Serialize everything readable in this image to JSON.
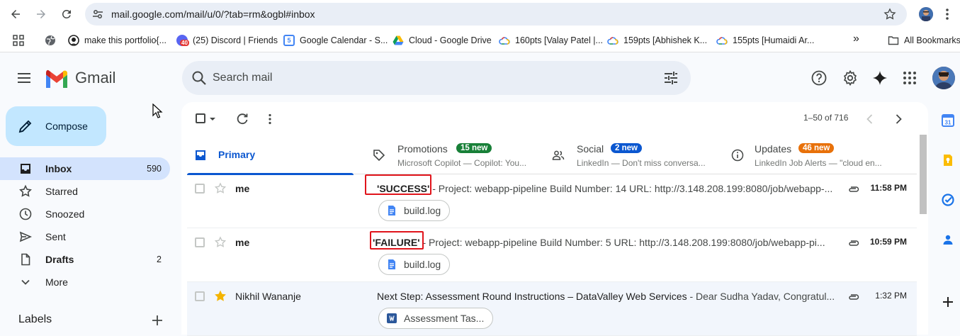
{
  "browser": {
    "url": "mail.google.com/mail/u/0/?tab=rm&ogbl#inbox",
    "bookmarks": [
      {
        "label": "make this portfolio{..."
      },
      {
        "label": "(25) Discord | Friends"
      },
      {
        "label": "Google Calendar - S..."
      },
      {
        "label": "Cloud - Google Drive"
      },
      {
        "label": "160pts [Valay Patel |..."
      },
      {
        "label": "159pts [Abhishek K..."
      },
      {
        "label": "155pts [Humaidi Ar..."
      }
    ],
    "overflow_label": "»",
    "all_bookmarks": "All Bookmarks",
    "discord_badge": "40"
  },
  "gmail": {
    "wordmark": "Gmail",
    "search_placeholder": "Search mail",
    "compose_label": "Compose"
  },
  "sidebar": {
    "items": [
      {
        "label": "Inbox",
        "count": "590"
      },
      {
        "label": "Starred",
        "count": ""
      },
      {
        "label": "Snoozed",
        "count": ""
      },
      {
        "label": "Sent",
        "count": ""
      },
      {
        "label": "Drafts",
        "count": "2"
      },
      {
        "label": "More",
        "count": ""
      }
    ],
    "labels_title": "Labels"
  },
  "toolbar": {
    "page_info": "1–50 of 716"
  },
  "tabs": [
    {
      "title": "Primary",
      "badge": "",
      "subtitle": ""
    },
    {
      "title": "Promotions",
      "badge": "15 new",
      "subtitle": "Microsoft Copilot — Copilot: You...",
      "badge_color": "#188038"
    },
    {
      "title": "Social",
      "badge": "2 new",
      "subtitle": "LinkedIn — Don't miss conversa...",
      "badge_color": "#0b57d0"
    },
    {
      "title": "Updates",
      "badge": "46 new",
      "subtitle": "LinkedIn Job Alerts — \"cloud en...",
      "badge_color": "#e8710a"
    }
  ],
  "emails": [
    {
      "sender": "me",
      "subject": "'SUCCESS'",
      "snippet": " - Project: webapp-pipeline Build Number: 14 URL: http://3.148.208.199:8080/job/webapp-...",
      "time": "11:58 PM",
      "attachment": "build.log",
      "starred": false,
      "unread": true
    },
    {
      "sender": "me",
      "subject": "'FAILURE'",
      "snippet": " - Project: webapp-pipeline Build Number: 5 URL: http://3.148.208.199:8080/job/webapp-pi...",
      "time": "10:59 PM",
      "attachment": "build.log",
      "starred": false,
      "unread": true
    },
    {
      "sender": "Nikhil Wananje",
      "subject": "Next Step: Assessment Round Instructions – DataValley Web Services",
      "snippet": " - Dear Sudha Yadav, Congratul...",
      "time": "1:32 PM",
      "attachment": "Assessment Tas...",
      "starred": true,
      "unread": false
    }
  ],
  "colors": {
    "accent": "#0b57d0",
    "highlight_box": "#e0141b",
    "compose_bg": "#c2e7ff",
    "active_nav": "#d3e3fd"
  }
}
